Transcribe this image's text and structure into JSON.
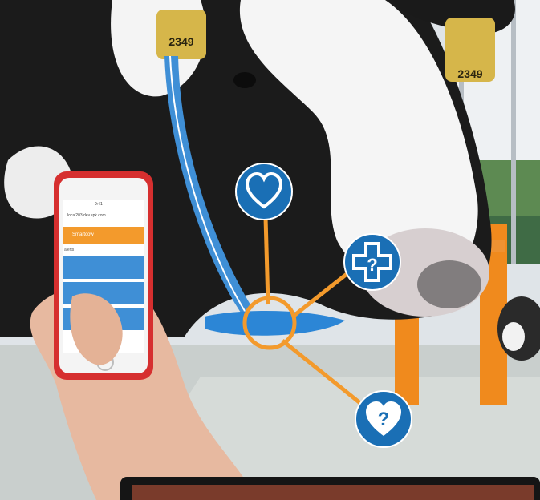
{
  "ear_tag": {
    "left_number": "2349",
    "right_number": "2349"
  },
  "phone": {
    "status_time": "9:41",
    "url": "local203.dev.spk.com",
    "header_label": "Smartcow",
    "section_label": "alerts"
  },
  "icons": {
    "top": "heart-icon",
    "right": "medical-question-icon",
    "bottom": "heart-question-icon"
  },
  "colors": {
    "accent_orange": "#f39a2c",
    "icon_blue": "#1a6fb5",
    "collar_blue": "#3f8fd6"
  }
}
